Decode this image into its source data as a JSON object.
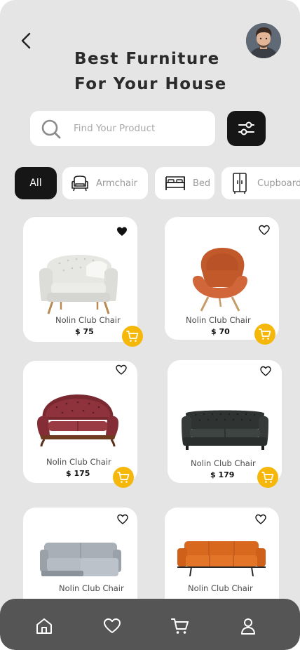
{
  "header": {
    "title_line1": "Best Furniture",
    "title_line2": "For Your House",
    "back_icon": "chevron-left-icon",
    "avatar": "user-avatar"
  },
  "search": {
    "placeholder": "Find Your Product",
    "value": "",
    "icon": "search-icon",
    "filter_icon": "sliders-icon"
  },
  "categories": [
    {
      "label": "All",
      "active": true
    },
    {
      "label": "Armchair",
      "icon": "armchair-icon"
    },
    {
      "label": "Bed",
      "icon": "bed-icon"
    },
    {
      "label": "Cupboard",
      "icon": "cupboard-icon"
    }
  ],
  "products": [
    {
      "name": "Nolin Club Chair",
      "price": "$ 75",
      "favorite": true
    },
    {
      "name": "Nolin Club Chair",
      "price": "$ 70",
      "favorite": false
    },
    {
      "name": "Nolin Club Chair",
      "price": "$ 175",
      "favorite": false
    },
    {
      "name": "Nolin Club Chair",
      "price": "$ 179",
      "favorite": false
    },
    {
      "name": "Nolin Club Chair",
      "price": "",
      "favorite": false
    },
    {
      "name": "Nolin Club Chair",
      "price": "",
      "favorite": false
    }
  ],
  "bottom_nav": [
    "home-icon",
    "heart-icon",
    "cart-icon",
    "user-icon"
  ],
  "colors": {
    "background": "#e5e5e5",
    "dark": "#161616",
    "accent": "#f5b70a",
    "nav": "#555555"
  }
}
